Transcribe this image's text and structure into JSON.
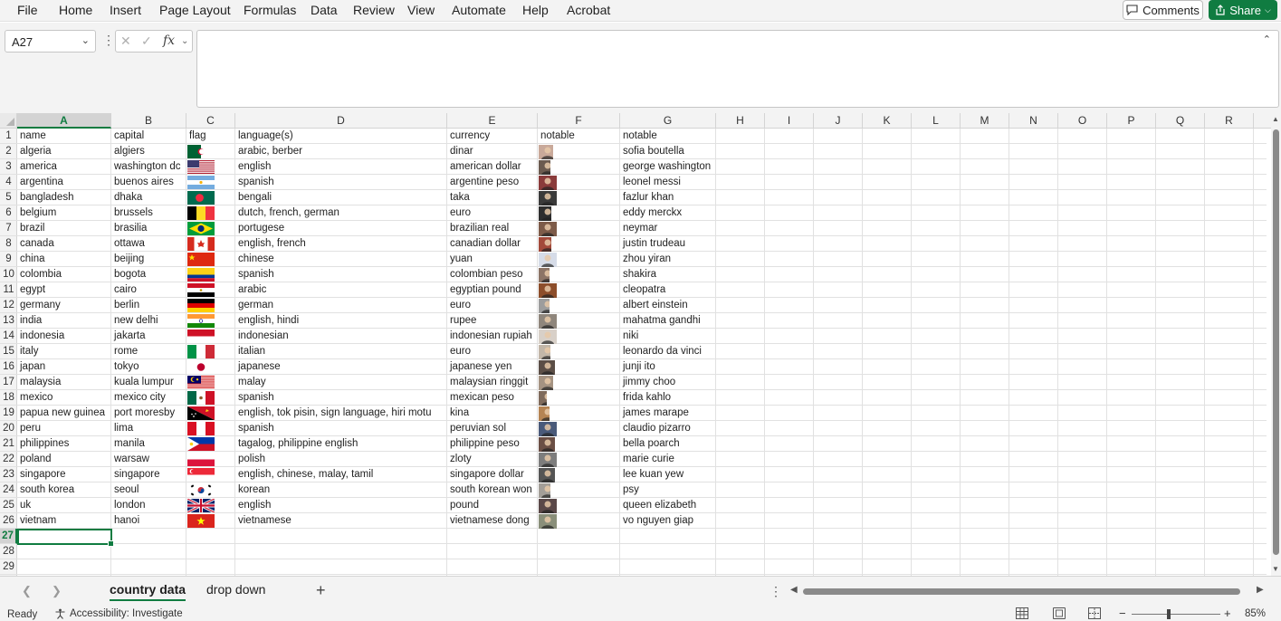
{
  "menu": [
    "File",
    "Home",
    "Insert",
    "Page Layout",
    "Formulas",
    "Data",
    "Review",
    "View",
    "Automate",
    "Help",
    "Acrobat"
  ],
  "toolbar": {
    "comments_label": "Comments",
    "share_label": "Share"
  },
  "namebox": {
    "value": "A27"
  },
  "formula": {
    "fx_label": "fx",
    "value": ""
  },
  "columns": [
    "A",
    "B",
    "C",
    "D",
    "E",
    "F",
    "G",
    "H",
    "I",
    "J",
    "K",
    "L",
    "M",
    "N",
    "O",
    "P",
    "Q",
    "R"
  ],
  "active_column": "A",
  "row_numbers": [
    "1",
    "2",
    "3",
    "4",
    "5",
    "6",
    "7",
    "8",
    "9",
    "10",
    "11",
    "12",
    "13",
    "14",
    "15",
    "16",
    "17",
    "18",
    "19",
    "20",
    "21",
    "22",
    "23",
    "24",
    "25",
    "26",
    "27",
    "28",
    "29"
  ],
  "active_row": "27",
  "table": {
    "headers": {
      "a": "name",
      "b": "capital",
      "c": "flag",
      "d": "language(s)",
      "e": "currency",
      "f": "notable",
      "g": "notable"
    },
    "rows": [
      {
        "name": "algeria",
        "capital": "algiers",
        "language": "arabic, berber",
        "currency": "dinar",
        "notable": "sofia boutella",
        "flag": "algeria"
      },
      {
        "name": "america",
        "capital": "washington dc",
        "language": "english",
        "currency": "american dollar",
        "notable": "george washington",
        "flag": "usa"
      },
      {
        "name": "argentina",
        "capital": "buenos aires",
        "language": "spanish",
        "currency": "argentine peso",
        "notable": "leonel messi",
        "flag": "argentina"
      },
      {
        "name": "bangladesh",
        "capital": "dhaka",
        "language": "bengali",
        "currency": "taka",
        "notable": "fazlur khan",
        "flag": "bangladesh"
      },
      {
        "name": "belgium",
        "capital": "brussels",
        "language": "dutch, french, german",
        "currency": "euro",
        "notable": "eddy merckx",
        "flag": "belgium"
      },
      {
        "name": "brazil",
        "capital": "brasilia",
        "language": "portugese",
        "currency": "brazilian real",
        "notable": "neymar",
        "flag": "brazil"
      },
      {
        "name": "canada",
        "capital": "ottawa",
        "language": "english, french",
        "currency": "canadian dollar",
        "notable": "justin trudeau",
        "flag": "canada"
      },
      {
        "name": "china",
        "capital": "beijing",
        "language": "chinese",
        "currency": "yuan",
        "notable": "zhou yiran",
        "flag": "china"
      },
      {
        "name": "colombia",
        "capital": "bogota",
        "language": "spanish",
        "currency": "colombian peso",
        "notable": "shakira",
        "flag": "colombia"
      },
      {
        "name": "egypt",
        "capital": "cairo",
        "language": "arabic",
        "currency": "egyptian pound",
        "notable": "cleopatra",
        "flag": "egypt"
      },
      {
        "name": "germany",
        "capital": "berlin",
        "language": "german",
        "currency": "euro",
        "notable": "albert einstein",
        "flag": "germany"
      },
      {
        "name": "india",
        "capital": "new delhi",
        "language": "english, hindi",
        "currency": "rupee",
        "notable": "mahatma gandhi",
        "flag": "india"
      },
      {
        "name": "indonesia",
        "capital": "jakarta",
        "language": "indonesian",
        "currency": "indonesian rupiah",
        "notable": "niki",
        "flag": "indonesia"
      },
      {
        "name": "italy",
        "capital": "rome",
        "language": "italian",
        "currency": "euro",
        "notable": "leonardo da vinci",
        "flag": "italy"
      },
      {
        "name": "japan",
        "capital": "tokyo",
        "language": "japanese",
        "currency": "japanese yen",
        "notable": "junji ito",
        "flag": "japan"
      },
      {
        "name": "malaysia",
        "capital": "kuala lumpur",
        "language": "malay",
        "currency": "malaysian ringgit",
        "notable": "jimmy choo",
        "flag": "malaysia"
      },
      {
        "name": "mexico",
        "capital": "mexico city",
        "language": "spanish",
        "currency": "mexican peso",
        "notable": "frida kahlo",
        "flag": "mexico"
      },
      {
        "name": "papua new guinea",
        "capital": "port moresby",
        "language": "english, tok pisin, sign language, hiri motu",
        "currency": "kina",
        "notable": "james marape",
        "flag": "png"
      },
      {
        "name": "peru",
        "capital": "lima",
        "language": "spanish",
        "currency": "peruvian sol",
        "notable": "claudio pizarro",
        "flag": "peru"
      },
      {
        "name": "philippines",
        "capital": "manila",
        "language": "tagalog, philippine english",
        "currency": "philippine peso",
        "notable": "bella poarch",
        "flag": "philippines"
      },
      {
        "name": "poland",
        "capital": "warsaw",
        "language": "polish",
        "currency": "zloty",
        "notable": "marie curie",
        "flag": "poland"
      },
      {
        "name": "singapore",
        "capital": "singapore",
        "language": "english, chinese, malay, tamil",
        "currency": "singapore dollar",
        "notable": "lee kuan yew",
        "flag": "singapore"
      },
      {
        "name": "south korea",
        "capital": "seoul",
        "language": "korean",
        "currency": "south korean won",
        "notable": "psy",
        "flag": "south-korea"
      },
      {
        "name": "uk",
        "capital": "london",
        "language": "english",
        "currency": "pound",
        "notable": "queen elizabeth",
        "flag": "uk"
      },
      {
        "name": "vietnam",
        "capital": "hanoi",
        "language": "vietnamese",
        "currency": "vietnamese dong",
        "notable": "vo nguyen giap",
        "flag": "vietnam"
      }
    ]
  },
  "sheets": [
    {
      "label": "country data",
      "active": true
    },
    {
      "label": "drop down",
      "active": false
    }
  ],
  "status": {
    "ready": "Ready",
    "accessibility": "Accessibility: Investigate",
    "zoom": "85%"
  },
  "colors": {
    "accent": "#107c41"
  }
}
